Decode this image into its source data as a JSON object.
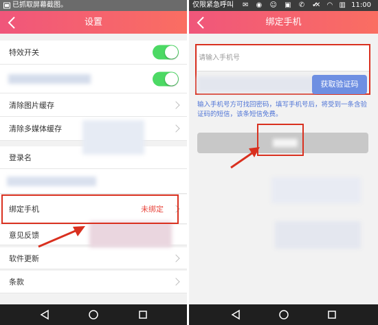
{
  "left_screen": {
    "status": {
      "text": "已抓取屏幕截图。"
    },
    "header": {
      "title": "设置"
    },
    "items": [
      {
        "label": "特效开关"
      },
      {
        "label": "清除图片缓存"
      },
      {
        "label": "清除多媒体缓存"
      },
      {
        "label": "登录名"
      },
      {
        "label": "绑定手机",
        "value": "未绑定"
      },
      {
        "label": "意见反馈"
      },
      {
        "label": "软件更新"
      },
      {
        "label": "条款"
      }
    ],
    "toggles": {
      "effects": true,
      "blurred_item": true
    }
  },
  "right_screen": {
    "status": {
      "left_text": "仅限紧急呼叫",
      "time": "11:00"
    },
    "header": {
      "title": "绑定手机"
    },
    "phone_input": {
      "placeholder": "请输入手机号",
      "value": ""
    },
    "get_code_button": "获取验证码",
    "hint": "输入手机号方可找回密码，填写手机号后，将受到一条含验证码的短信，该条短信免费。"
  },
  "colors": {
    "header_start": "#f0567b",
    "header_end": "#fa6e62",
    "toggle_on": "#4cd964",
    "accent_red": "#e8453c",
    "annotation": "#d9301f",
    "code_button": "#6e8fe2",
    "hint": "#4f74d6"
  }
}
